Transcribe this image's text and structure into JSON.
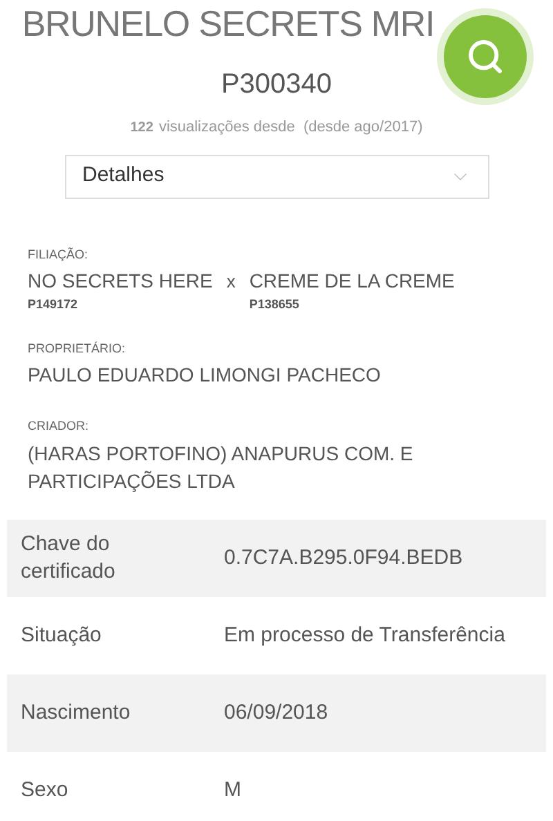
{
  "header": {
    "title": "BRUNELO SECRETS MRI",
    "code": "P300340",
    "views_count": "122",
    "views_text": "visualizações desde  (desde ago/2017)"
  },
  "dropdown": {
    "value": "Detalhes"
  },
  "pedigree": {
    "label": "FILIAÇÃO:",
    "sire": {
      "name": "NO SECRETS HERE",
      "code": "P149172"
    },
    "separator": "x",
    "dam": {
      "name": "CREME DE LA CREME",
      "code": "P138655"
    }
  },
  "owner": {
    "label": "PROPRIETÁRIO:",
    "value": "PAULO EDUARDO LIMONGI PACHECO"
  },
  "breeder": {
    "label": "CRIADOR:",
    "value": "(HARAS PORTOFINO) ANAPURUS COM. E PARTICIPAÇÕES LTDA"
  },
  "details": [
    {
      "label": "Chave do certificado",
      "value": "0.7C7A.B295.0F94.BEDB"
    },
    {
      "label": "Situação",
      "value": "Em processo de Transferência"
    },
    {
      "label": "Nascimento",
      "value": "06/09/2018"
    },
    {
      "label": "Sexo",
      "value": "M"
    }
  ]
}
